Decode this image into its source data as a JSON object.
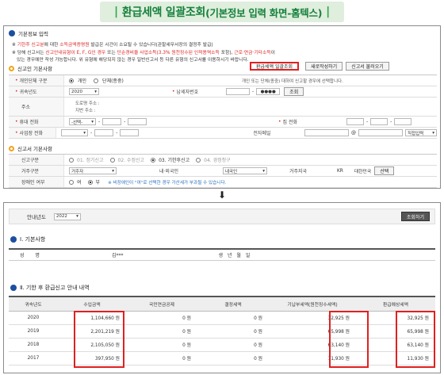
{
  "banner": {
    "title": "환급세액 일괄조회",
    "subtitle": "(기본정보 입력 화면-홈텍스)"
  },
  "panel1": {
    "section_basic": "기본정보 입력",
    "notice1": {
      "pre": "※ ",
      "red1": "기한후 신고분",
      "mid": "에 대한 ",
      "red2": "소득금액증명원",
      "post": " 발급은 시간이 소요될 수 있습니다(관할세무서장의 결정후 발급)"
    },
    "notice2": {
      "pre": "※ 당해 신고서는 ",
      "red1": "신고안내유형이 E, F, G인 경우",
      "mid": " 또는 ",
      "red2": "단순경비율 사업소득(3.3% 원천징수된 인적용역소득",
      "mid2": " 포함), ",
      "red3": "근로·연금·기타소득",
      "post": "이"
    },
    "notice3": "있는 경우에만 작성 가능합니다. 위 유형에 해당되지 않는 경우 일반신고서 등 다른 유형의 신고서를 이용하시기 바랍니다.",
    "section_taxpayer": "신고인 기본사항",
    "btn_bulk": "환급세액 일괄조회",
    "btn_new": "새로작성하기",
    "btn_load": "신고서 불러오기",
    "rows": {
      "type_label": "개인단체 구분",
      "type_opt1": "개인",
      "type_opt2": "단체(종중)",
      "type_note": "개인 또는 단체(종중) 대하여 신고할 경우에 선택합니다.",
      "year_label": "귀속년도",
      "year_value": "2020",
      "taxid_label": "납세자번호",
      "taxid_mask": "●●●●",
      "lookup": "조회",
      "addr_label": "주소",
      "addr_road": "도로명 주소 :",
      "addr_lot": "지번 주소 :",
      "mobile_label": "휴대 전화",
      "mobile_sel": "-선택-",
      "home_label": "집 전화",
      "biz_label": "사업장 전화",
      "email_label": "전자메일",
      "email_at": "@",
      "email_sel": "직접입력"
    },
    "section_report": "신고서 기본사항",
    "report": {
      "kind_label": "신고구분",
      "kind1": "01. 정기신고",
      "kind2": "02. 수정신고",
      "kind3": "03. 기한후신고",
      "kind4": "04. 경정청구",
      "res_label": "거주구분",
      "res_value": "거주자",
      "nat_label": "내·외국인",
      "nat_value": "내국인",
      "country_label": "거주지국",
      "country_code": "KR",
      "country_name": "대한민국",
      "country_btn": "선택",
      "dis_label": "장애인 여부",
      "dis_yes": "여",
      "dis_no": "부",
      "dis_note": "※ 비장애인이 \"여\"로 선택한 경우 가산세가 부과될 수 있습니다."
    }
  },
  "panel2": {
    "year_label": "안내년도",
    "year_value": "2022",
    "lookup_btn": "조회하기",
    "section1": "Ⅰ. 기본사항",
    "name_label": "성 명",
    "name_value": "김***",
    "birth_label": "생 년 월 일",
    "section2": "Ⅱ. 기한 후 환급신고 안내 내역",
    "headers": [
      "귀속년도",
      "수입금액",
      "국민연금공제",
      "결정세액",
      "기납부세액(원천징수세액)",
      "환급예상세액"
    ],
    "rows": [
      [
        "2020",
        "1,104,660 원",
        "0 원",
        "0 원",
        "32,925 원",
        "32,925 원"
      ],
      [
        "2019",
        "2,201,219 원",
        "0 원",
        "0 원",
        "65,998 원",
        "65,998 원"
      ],
      [
        "2018",
        "2,105,050 원",
        "0 원",
        "0 원",
        "63,140 원",
        "63,140 원"
      ],
      [
        "2017",
        "397,950 원",
        "0 원",
        "0 원",
        "11,930 원",
        "11,930 원"
      ]
    ]
  },
  "colors": {
    "banner_bg": "#dfeedd",
    "banner_text": "#15813c",
    "highlight": "#e02020",
    "section_bullet": "#1b4fa0"
  }
}
